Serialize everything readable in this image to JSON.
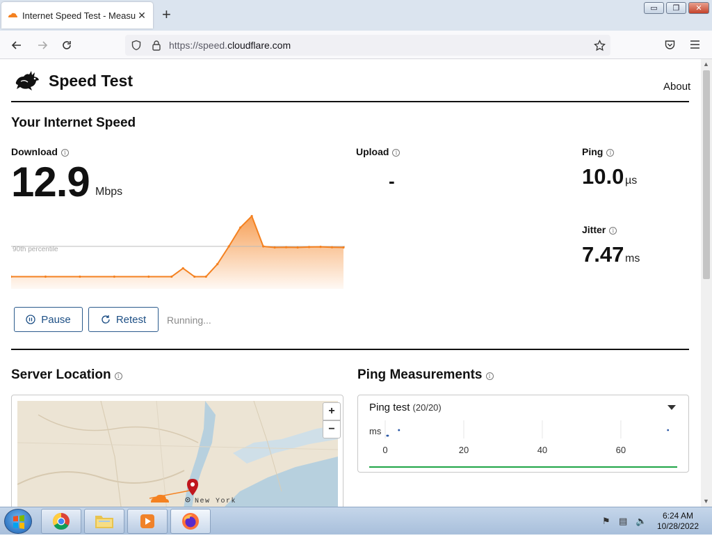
{
  "browser": {
    "tab_title": "Internet Speed Test - Measure N",
    "tab_close": "✕",
    "new_tab": "+",
    "url_prefix": "https://speed.",
    "url_domain": "cloudflare.com",
    "window_controls": {
      "minimize": "▭",
      "maximize": "❐",
      "close": "✕"
    }
  },
  "header": {
    "title": "Speed Test",
    "about_link": "About"
  },
  "speed": {
    "heading": "Your Internet Speed",
    "download_label": "Download",
    "download_value": "12.9",
    "download_unit": "Mbps",
    "upload_label": "Upload",
    "upload_value": "-",
    "ping_label": "Ping",
    "ping_value": "10.0",
    "ping_unit": "µs",
    "jitter_label": "Jitter",
    "jitter_value": "7.47",
    "jitter_unit": "ms",
    "percentile_label": "90th percentile",
    "info_glyph": "i"
  },
  "chart_data": {
    "type": "area",
    "title": "",
    "xlabel": "",
    "ylabel": "",
    "ylim": [
      0,
      30
    ],
    "points": [
      0.5,
      0.5,
      0.5,
      0.5,
      0.5,
      0.5,
      0.5,
      0.5,
      0.5,
      0.5,
      0.5,
      0.5,
      0.5,
      0.5,
      0.5,
      4.5,
      0.5,
      0.5,
      6.5,
      15,
      24,
      29.5,
      15,
      14.5,
      14.6,
      14.5,
      14.7,
      14.8,
      14.6,
      14.5
    ],
    "percentile_value": 15,
    "color": "#f48120"
  },
  "controls": {
    "pause_label": "Pause",
    "retest_label": "Retest",
    "status_text": "Running..."
  },
  "server": {
    "heading": "Server Location",
    "city_label": "New York",
    "zoom_in": "+",
    "zoom_out": "−"
  },
  "ping_measurements": {
    "heading": "Ping Measurements",
    "dropdown_title": "Ping test",
    "dropdown_count": "(20/20)",
    "axis_unit": "ms",
    "ticks": [
      "0",
      "20",
      "40",
      "60"
    ],
    "tick_values": [
      0,
      20,
      40,
      60
    ],
    "xlim": [
      0,
      74
    ],
    "samples": [
      0.5,
      0.7,
      3.5,
      3.5,
      72
    ]
  },
  "taskbar": {
    "time": "6:24 AM",
    "date": "10/28/2022",
    "apps": [
      "chrome-icon",
      "file-explorer-icon",
      "media-player-icon",
      "firefox-icon"
    ]
  },
  "colors": {
    "accent_orange": "#f48120",
    "button_blue": "#1d4f85",
    "ping_green": "#1ea446"
  }
}
